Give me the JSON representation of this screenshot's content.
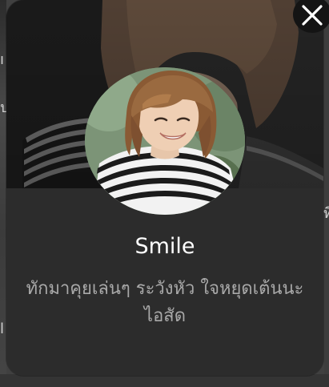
{
  "profile": {
    "display_name": "Smile",
    "status_message": "ทักมาคุยเล่นๆ ระวังหัว ใจหยุดเต้นนะไอสัด"
  },
  "background": {
    "edge_glyphs": [
      "ı",
      "ป",
      "ที",
      "l"
    ]
  },
  "icons": {
    "close": "close-icon"
  },
  "colors": {
    "card_background": "#2c2c2c",
    "name_text": "#ffffff",
    "status_text": "#a9a9a9",
    "close_button": "#141414"
  }
}
